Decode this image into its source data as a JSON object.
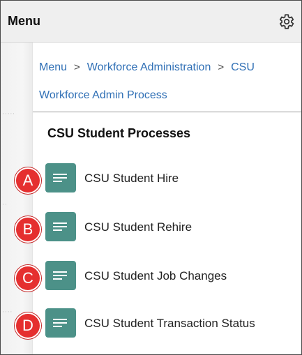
{
  "header": {
    "title": "Menu",
    "settings_icon": "gear-icon"
  },
  "breadcrumb": {
    "items": [
      "Menu",
      "Workforce Administration",
      "CSU",
      "Workforce Admin Process"
    ],
    "separator": ">"
  },
  "section": {
    "title": "CSU Student Processes"
  },
  "items": [
    {
      "badge": "A",
      "label": "CSU Student Hire",
      "icon": "list-lines-icon"
    },
    {
      "badge": "B",
      "label": "CSU Student Rehire",
      "icon": "list-lines-icon"
    },
    {
      "badge": "C",
      "label": "CSU Student Job Changes",
      "icon": "list-lines-icon"
    },
    {
      "badge": "D",
      "label": "CSU Student Transaction Status",
      "icon": "list-lines-icon"
    }
  ],
  "colors": {
    "header_bg": "#efefef",
    "link": "#2f6fb5",
    "tile": "#4c9188",
    "badge": "#e52f2f"
  }
}
